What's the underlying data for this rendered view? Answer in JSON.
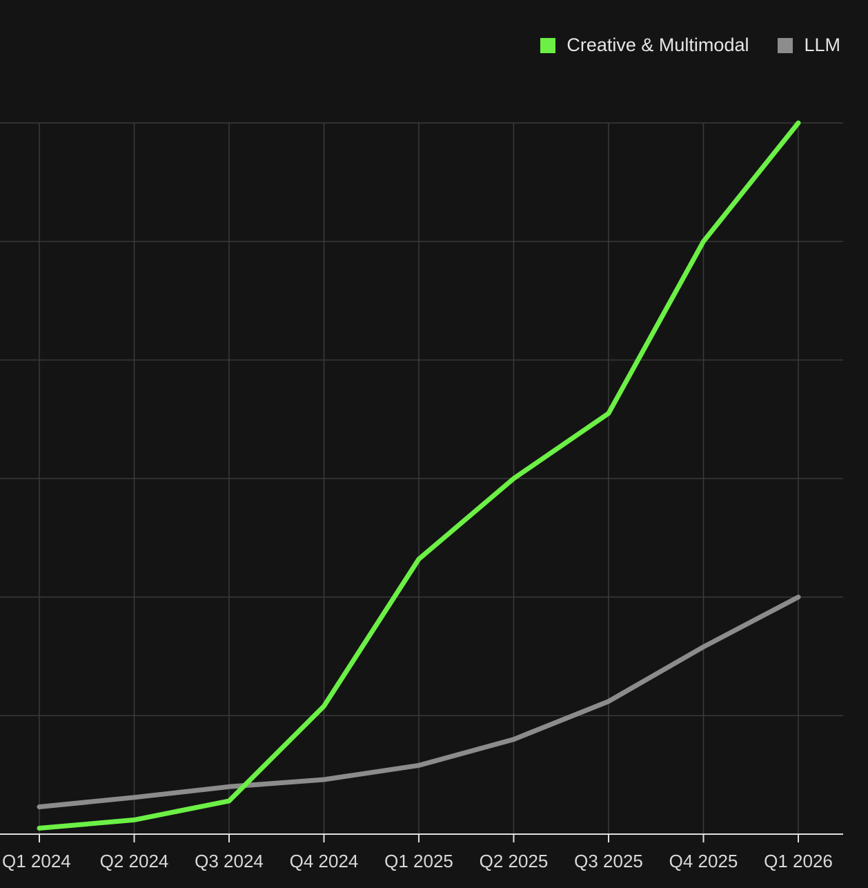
{
  "chart_data": {
    "type": "line",
    "categories": [
      "Q1 2024",
      "Q2 2024",
      "Q3 2024",
      "Q4 2024",
      "Q1 2025",
      "Q2 2025",
      "Q3 2025",
      "Q4 2025",
      "Q1 2026"
    ],
    "series": [
      {
        "name": "Creative & Multimodal",
        "color": "#6cf046",
        "values": [
          0.5,
          1.2,
          2.8,
          10.8,
          23.2,
          30.0,
          35.5,
          50.0,
          60.0
        ]
      },
      {
        "name": "LLM",
        "color": "#8c8c8c",
        "values": [
          2.3,
          3.1,
          4.0,
          4.6,
          5.8,
          8.0,
          11.2,
          15.8,
          20.0
        ]
      }
    ],
    "ylim": [
      0,
      60
    ],
    "yticks": [
      0,
      10,
      20,
      30,
      40,
      50,
      60
    ],
    "grid": true,
    "legend": "top-right",
    "title": "",
    "xlabel": "",
    "ylabel": ""
  }
}
